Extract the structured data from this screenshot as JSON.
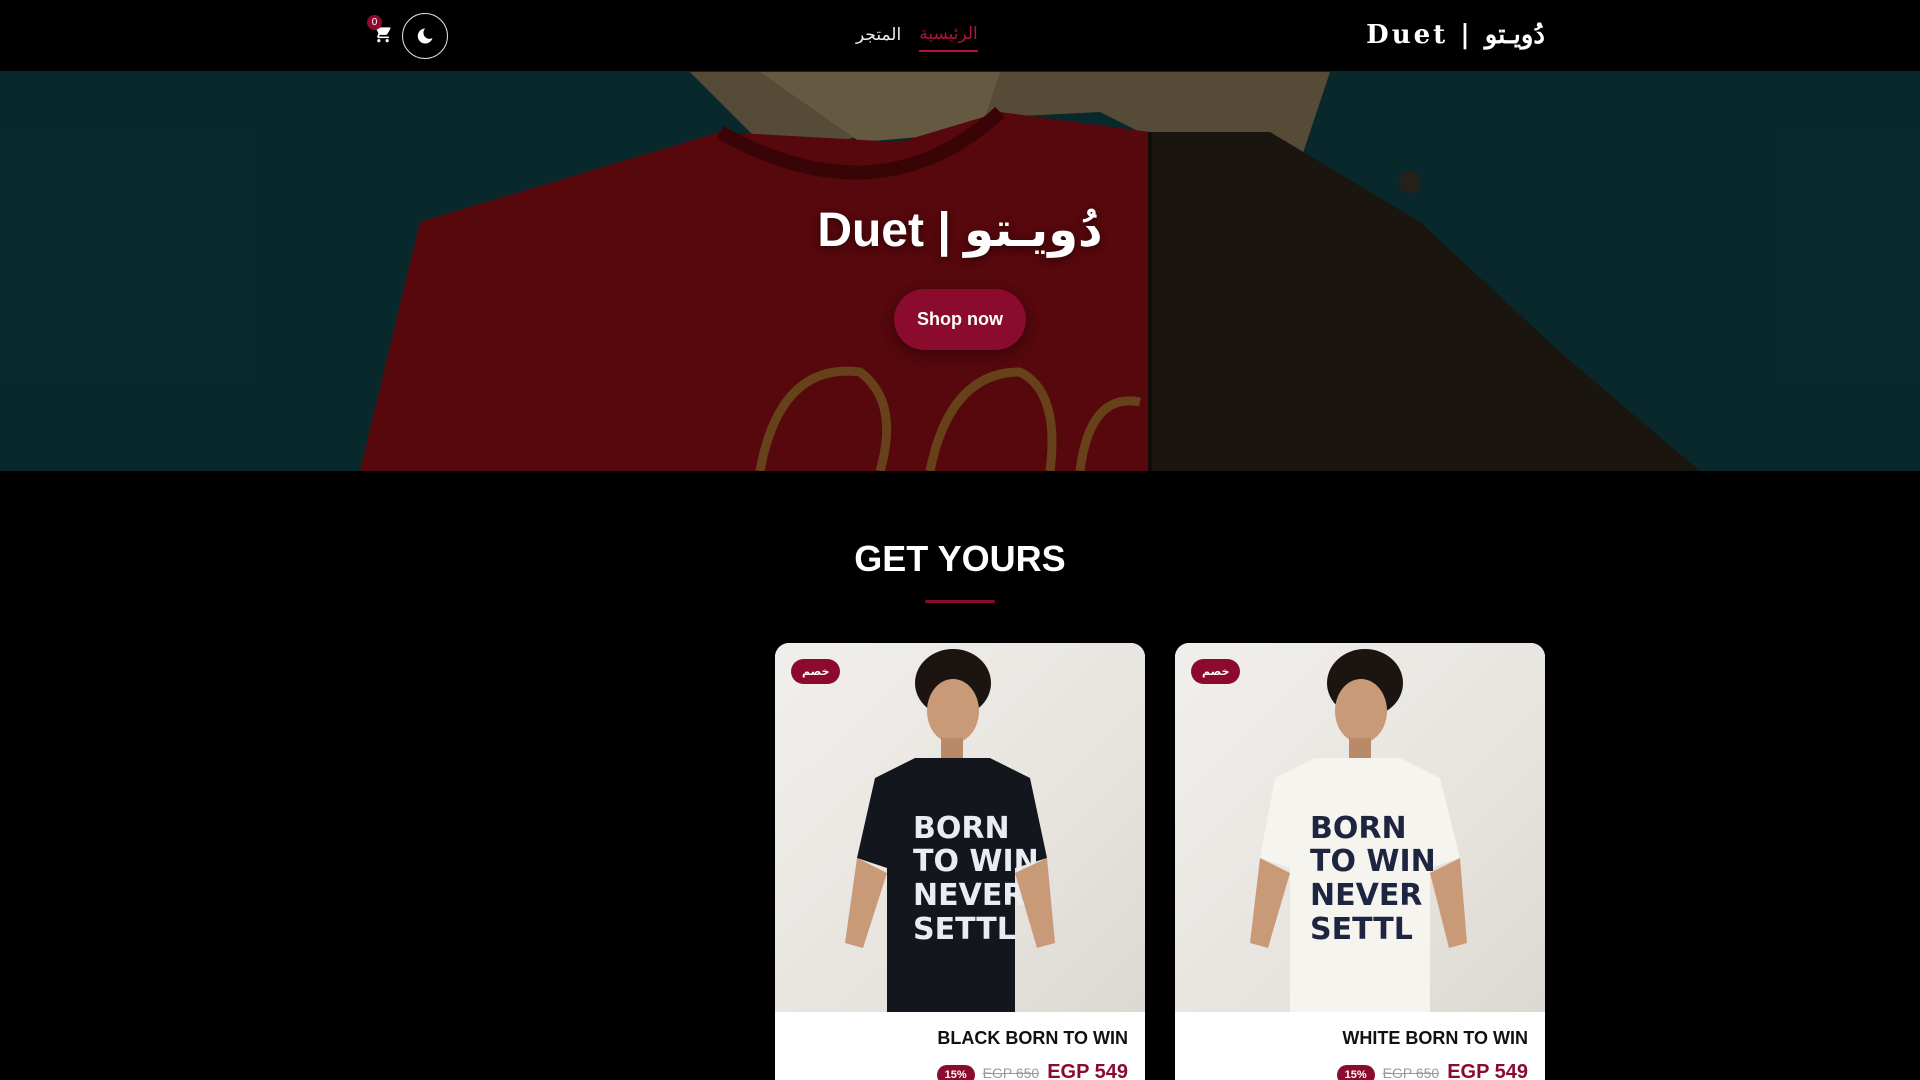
{
  "navbar": {
    "brand": "Duet | دُويـتو",
    "links": [
      {
        "label": "المتجر",
        "active": false
      },
      {
        "label": "الرئيسية",
        "active": true
      }
    ],
    "cart_count": "0",
    "icons": {
      "cart": "cart-icon",
      "theme": "moon-icon"
    }
  },
  "hero": {
    "title": "Duet | دُويـتو",
    "cta": "Shop now"
  },
  "section": {
    "title": "GET YOURS"
  },
  "products": [
    {
      "badge": "خصم",
      "name": "BLACK BORN TO WIN",
      "discount": "15%",
      "old_price": "EGP 650",
      "price": "EGP 549"
    },
    {
      "badge": "خصم",
      "name": "WHITE BORN TO WIN",
      "discount": "15%",
      "old_price": "EGP 650",
      "price": "EGP 549"
    }
  ],
  "colors": {
    "accent": "#8a0b2d",
    "background": "#000000"
  }
}
